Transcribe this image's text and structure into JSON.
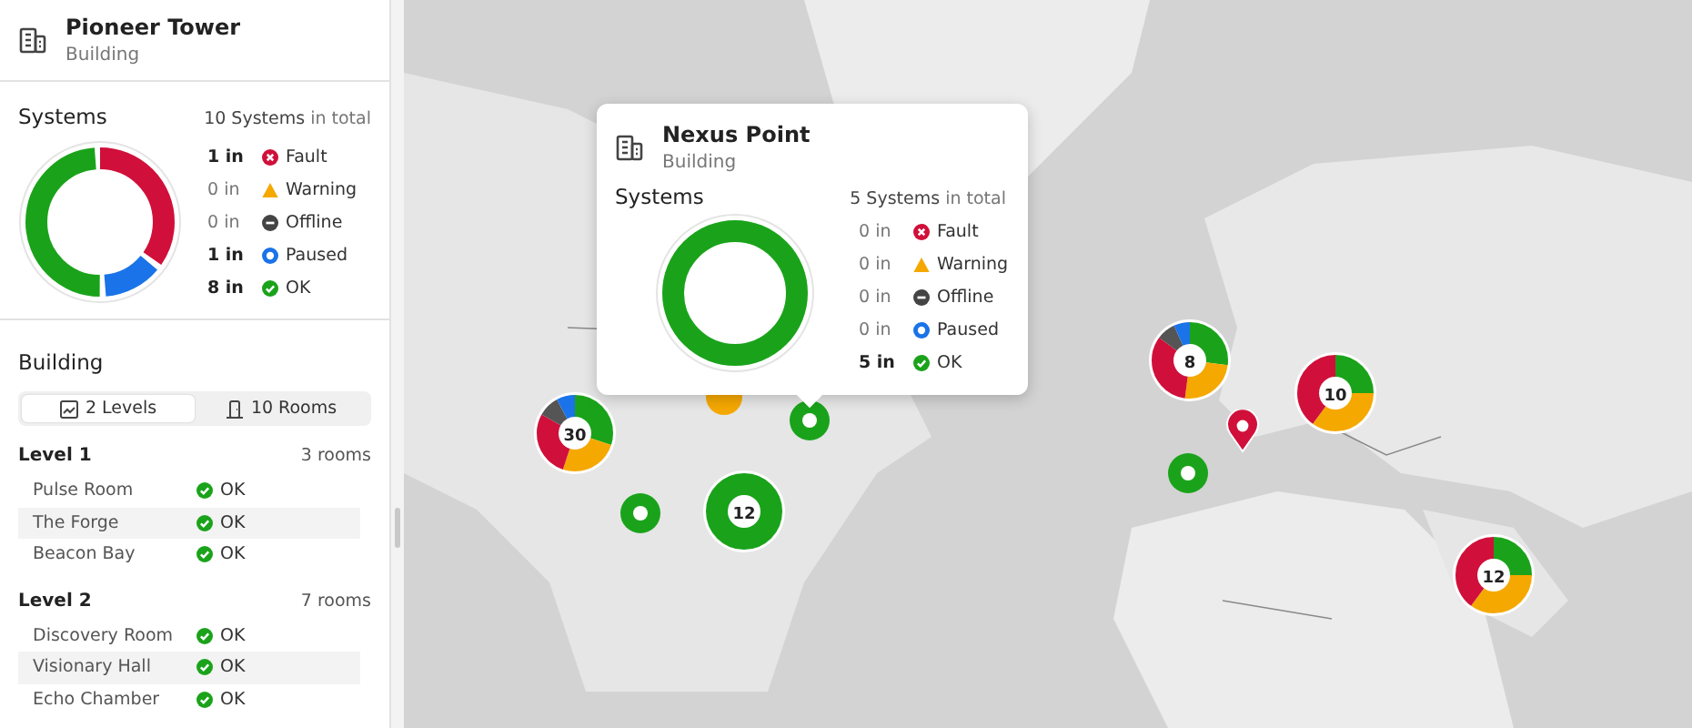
{
  "building": {
    "name": "Pioneer Tower",
    "type": "Building"
  },
  "systems": {
    "title": "Systems",
    "total": "10 Systems",
    "total_suffix": "in total",
    "segments": [
      {
        "color": "#d0103a",
        "level": 0.36
      },
      {
        "color": "#1a73e8",
        "level": 0.14
      },
      {
        "color": "#1aa31a",
        "level": 0.5
      }
    ],
    "statuses": [
      {
        "kind": "fault",
        "count": "1 in",
        "label": "Fault",
        "highlighted": true
      },
      {
        "kind": "warning",
        "count": "0 in",
        "label": "Warning",
        "highlighted": false
      },
      {
        "kind": "offline",
        "count": "0 in",
        "label": "Offline",
        "highlighted": false
      },
      {
        "kind": "paused",
        "count": "1 in",
        "label": "Paused",
        "highlighted": true
      },
      {
        "kind": "ok",
        "count": "8 in",
        "label": "OK",
        "highlighted": true
      }
    ]
  },
  "structure": {
    "title": "Building",
    "tabs": [
      {
        "kind": "levels",
        "label": "2 Levels",
        "selected": true
      },
      {
        "kind": "rooms",
        "label": "10 Rooms",
        "selected": false
      }
    ],
    "levels": [
      {
        "name": "Level 1",
        "count": "3 rooms",
        "rooms": [
          {
            "name": "Pulse Room",
            "kind": "ok",
            "label": "OK"
          },
          {
            "name": "The Forge",
            "kind": "ok",
            "label": "OK"
          },
          {
            "name": "Beacon Bay",
            "kind": "ok",
            "label": "OK"
          }
        ]
      },
      {
        "name": "Level 2",
        "count": "7 rooms",
        "rooms": [
          {
            "name": "Discovery Room",
            "kind": "ok",
            "label": "OK"
          },
          {
            "name": "Visionary Hall",
            "kind": "ok",
            "label": "OK"
          },
          {
            "name": "Echo Chamber",
            "kind": "ok",
            "label": "OK"
          }
        ]
      }
    ]
  },
  "map": {
    "markers": [
      {
        "kind": "dot",
        "color": "#f5a800"
      },
      {
        "kind": "cluster",
        "count": "30",
        "segments": [
          {
            "kind": "ok",
            "level": 0.3
          },
          {
            "kind": "warning",
            "level": 0.25
          },
          {
            "kind": "fault",
            "level": 0.28
          },
          {
            "kind": "offline",
            "level": 0.09
          },
          {
            "kind": "paused",
            "level": 0.08
          }
        ]
      },
      {
        "kind": "ring",
        "color": "#1aa31a"
      },
      {
        "kind": "ring",
        "color": "#1aa31a"
      },
      {
        "kind": "cluster",
        "count": "12",
        "segments": [
          {
            "kind": "ok",
            "level": 1
          }
        ]
      },
      {
        "kind": "cluster",
        "count": "8",
        "segments": [
          {
            "kind": "ok",
            "level": 0.27
          },
          {
            "kind": "warning",
            "level": 0.25
          },
          {
            "kind": "fault",
            "level": 0.33
          },
          {
            "kind": "offline",
            "level": 0.08
          },
          {
            "kind": "paused",
            "level": 0.07
          }
        ]
      },
      {
        "kind": "cluster",
        "count": "10",
        "segments": [
          {
            "kind": "ok",
            "level": 0.25
          },
          {
            "kind": "warning",
            "level": 0.35
          },
          {
            "kind": "fault",
            "level": 0.4
          }
        ]
      },
      {
        "kind": "pin",
        "color": "#d0103a"
      },
      {
        "kind": "ring",
        "color": "#1aa31a"
      },
      {
        "kind": "cluster",
        "count": "12",
        "segments": [
          {
            "kind": "ok",
            "level": 0.25
          },
          {
            "kind": "warning",
            "level": 0.35
          },
          {
            "kind": "fault",
            "level": 0.4
          }
        ]
      }
    ]
  },
  "popup": {
    "name": "Nexus Point",
    "type": "Building",
    "title": "Systems",
    "total": "5 Systems",
    "total_suffix": "in total",
    "segments": [
      {
        "color": "#1aa31a",
        "level": 1
      }
    ],
    "statuses": [
      {
        "kind": "fault",
        "count": "0 in",
        "label": "Fault",
        "highlighted": false
      },
      {
        "kind": "warning",
        "count": "0 in",
        "label": "Warning",
        "highlighted": false
      },
      {
        "kind": "offline",
        "count": "0 in",
        "label": "Offline",
        "highlighted": false
      },
      {
        "kind": "paused",
        "count": "0 in",
        "label": "Paused",
        "highlighted": false
      },
      {
        "kind": "ok",
        "count": "5 in",
        "label": "OK",
        "highlighted": true
      }
    ]
  }
}
